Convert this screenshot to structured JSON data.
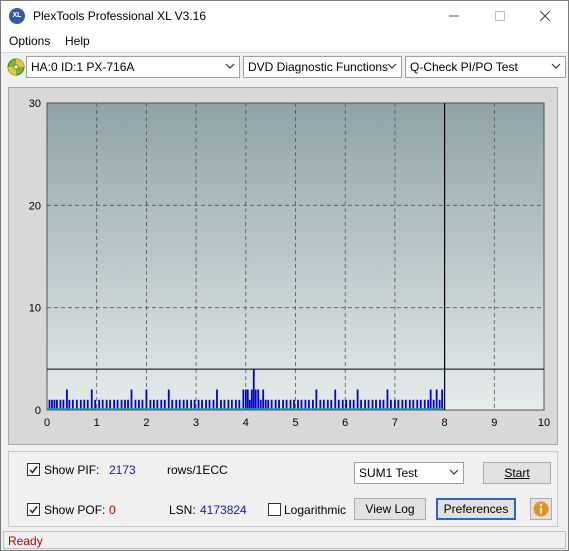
{
  "window": {
    "title": "PlexTools Professional XL V3.16",
    "icon_text": "XL"
  },
  "menu": {
    "options": "Options",
    "help": "Help"
  },
  "toolbar": {
    "drive": "HA:0 ID:1  PX-716A",
    "function": "DVD Diagnostic Functions",
    "test": "Q-Check PI/PO Test"
  },
  "chart_data": {
    "type": "bar",
    "x_ticks": [
      "0",
      "1",
      "2",
      "3",
      "4",
      "5",
      "6",
      "7",
      "8",
      "9",
      "10"
    ],
    "y_ticks": [
      "0",
      "10",
      "20",
      "30"
    ],
    "xlim": [
      0,
      10
    ],
    "ylim": [
      0,
      30
    ],
    "threshold": 4,
    "disc_end": 8,
    "grid": true,
    "colors": {
      "pi_bars": "#0000e0",
      "pif_line": "#00b0a0",
      "plot_top": "#8fa3a8",
      "plot_bottom": "#e6ecec"
    },
    "pif_values": [
      {
        "x": 0.05,
        "y": 1
      },
      {
        "x": 0.1,
        "y": 1
      },
      {
        "x": 0.15,
        "y": 1
      },
      {
        "x": 0.2,
        "y": 1
      },
      {
        "x": 0.27,
        "y": 1
      },
      {
        "x": 0.33,
        "y": 1
      },
      {
        "x": 0.4,
        "y": 2
      },
      {
        "x": 0.45,
        "y": 1
      },
      {
        "x": 0.52,
        "y": 1
      },
      {
        "x": 0.6,
        "y": 1
      },
      {
        "x": 0.68,
        "y": 1
      },
      {
        "x": 0.75,
        "y": 1
      },
      {
        "x": 0.82,
        "y": 1
      },
      {
        "x": 0.9,
        "y": 2
      },
      {
        "x": 0.97,
        "y": 1
      },
      {
        "x": 1.05,
        "y": 1
      },
      {
        "x": 1.12,
        "y": 1
      },
      {
        "x": 1.2,
        "y": 1
      },
      {
        "x": 1.27,
        "y": 1
      },
      {
        "x": 1.35,
        "y": 1
      },
      {
        "x": 1.42,
        "y": 1
      },
      {
        "x": 1.5,
        "y": 1
      },
      {
        "x": 1.57,
        "y": 1
      },
      {
        "x": 1.63,
        "y": 1
      },
      {
        "x": 1.7,
        "y": 2
      },
      {
        "x": 1.78,
        "y": 1
      },
      {
        "x": 1.85,
        "y": 1
      },
      {
        "x": 1.92,
        "y": 1
      },
      {
        "x": 2.0,
        "y": 2
      },
      {
        "x": 2.08,
        "y": 1
      },
      {
        "x": 2.15,
        "y": 1
      },
      {
        "x": 2.22,
        "y": 1
      },
      {
        "x": 2.3,
        "y": 1
      },
      {
        "x": 2.37,
        "y": 1
      },
      {
        "x": 2.45,
        "y": 2
      },
      {
        "x": 2.52,
        "y": 1
      },
      {
        "x": 2.6,
        "y": 1
      },
      {
        "x": 2.67,
        "y": 1
      },
      {
        "x": 2.75,
        "y": 1
      },
      {
        "x": 2.82,
        "y": 1
      },
      {
        "x": 2.9,
        "y": 1
      },
      {
        "x": 2.97,
        "y": 1
      },
      {
        "x": 3.05,
        "y": 1
      },
      {
        "x": 3.12,
        "y": 1
      },
      {
        "x": 3.2,
        "y": 1
      },
      {
        "x": 3.27,
        "y": 1
      },
      {
        "x": 3.35,
        "y": 1
      },
      {
        "x": 3.42,
        "y": 2
      },
      {
        "x": 3.5,
        "y": 1
      },
      {
        "x": 3.57,
        "y": 1
      },
      {
        "x": 3.65,
        "y": 1
      },
      {
        "x": 3.72,
        "y": 1
      },
      {
        "x": 3.8,
        "y": 1
      },
      {
        "x": 3.87,
        "y": 1
      },
      {
        "x": 3.95,
        "y": 2
      },
      {
        "x": 4.0,
        "y": 2
      },
      {
        "x": 4.04,
        "y": 2
      },
      {
        "x": 4.08,
        "y": 1
      },
      {
        "x": 4.12,
        "y": 2
      },
      {
        "x": 4.16,
        "y": 4
      },
      {
        "x": 4.2,
        "y": 2
      },
      {
        "x": 4.25,
        "y": 2
      },
      {
        "x": 4.3,
        "y": 1
      },
      {
        "x": 4.35,
        "y": 2
      },
      {
        "x": 4.4,
        "y": 1
      },
      {
        "x": 4.45,
        "y": 1
      },
      {
        "x": 4.52,
        "y": 1
      },
      {
        "x": 4.6,
        "y": 1
      },
      {
        "x": 4.67,
        "y": 1
      },
      {
        "x": 4.75,
        "y": 1
      },
      {
        "x": 4.82,
        "y": 1
      },
      {
        "x": 4.9,
        "y": 1
      },
      {
        "x": 4.97,
        "y": 1
      },
      {
        "x": 5.05,
        "y": 1
      },
      {
        "x": 5.12,
        "y": 1
      },
      {
        "x": 5.2,
        "y": 1
      },
      {
        "x": 5.27,
        "y": 1
      },
      {
        "x": 5.35,
        "y": 1
      },
      {
        "x": 5.42,
        "y": 2
      },
      {
        "x": 5.5,
        "y": 1
      },
      {
        "x": 5.57,
        "y": 1
      },
      {
        "x": 5.65,
        "y": 1
      },
      {
        "x": 5.72,
        "y": 1
      },
      {
        "x": 5.8,
        "y": 2
      },
      {
        "x": 5.87,
        "y": 1
      },
      {
        "x": 5.95,
        "y": 1
      },
      {
        "x": 6.02,
        "y": 1
      },
      {
        "x": 6.1,
        "y": 1
      },
      {
        "x": 6.17,
        "y": 1
      },
      {
        "x": 6.25,
        "y": 2
      },
      {
        "x": 6.32,
        "y": 1
      },
      {
        "x": 6.4,
        "y": 1
      },
      {
        "x": 6.47,
        "y": 1
      },
      {
        "x": 6.55,
        "y": 1
      },
      {
        "x": 6.62,
        "y": 1
      },
      {
        "x": 6.7,
        "y": 1
      },
      {
        "x": 6.77,
        "y": 1
      },
      {
        "x": 6.85,
        "y": 2
      },
      {
        "x": 6.92,
        "y": 1
      },
      {
        "x": 7.0,
        "y": 1
      },
      {
        "x": 7.07,
        "y": 1
      },
      {
        "x": 7.15,
        "y": 1
      },
      {
        "x": 7.22,
        "y": 1
      },
      {
        "x": 7.3,
        "y": 1
      },
      {
        "x": 7.37,
        "y": 1
      },
      {
        "x": 7.45,
        "y": 1
      },
      {
        "x": 7.52,
        "y": 1
      },
      {
        "x": 7.6,
        "y": 1
      },
      {
        "x": 7.67,
        "y": 1
      },
      {
        "x": 7.72,
        "y": 2
      },
      {
        "x": 7.78,
        "y": 1
      },
      {
        "x": 7.84,
        "y": 2
      },
      {
        "x": 7.9,
        "y": 1
      },
      {
        "x": 7.95,
        "y": 2
      }
    ]
  },
  "controls": {
    "show_pif_label": "Show PIF:",
    "pif_value": "2173",
    "pif_unit": "rows/1ECC",
    "show_pof_label": "Show POF:",
    "pof_value": "0",
    "lsn_label": "LSN:",
    "lsn_value": "4173824",
    "log_label": "Logarithmic",
    "test_mode": "SUM1 Test",
    "start_label": "Start",
    "viewlog_label": "View Log",
    "prefs_label": "Preferences"
  },
  "status": {
    "text": "Ready"
  }
}
